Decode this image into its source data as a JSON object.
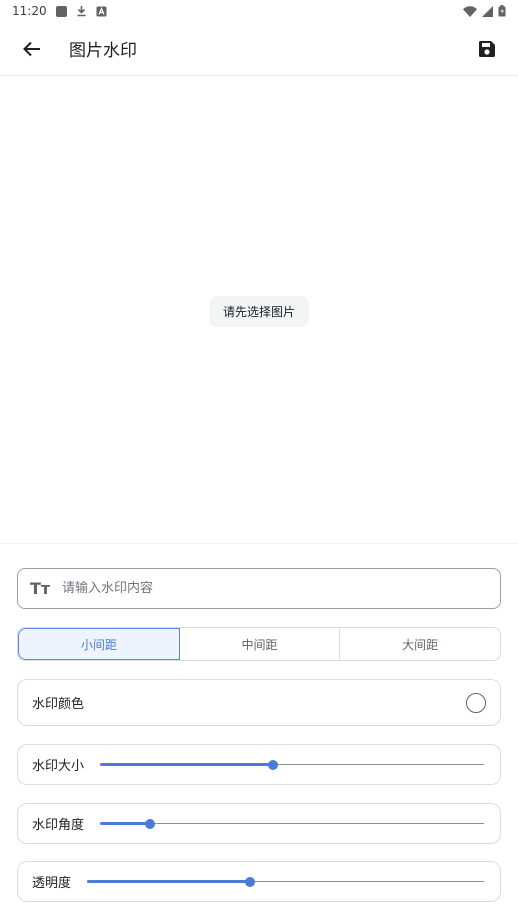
{
  "status_bar": {
    "time": "11:20"
  },
  "app_bar": {
    "title": "图片水印",
    "back_icon": "arrow-back-icon",
    "save_icon": "save-icon"
  },
  "preview": {
    "hint": "请先选择图片"
  },
  "text_input": {
    "placeholder": "请输入水印内容",
    "value": "",
    "icon": "text-fields-icon",
    "icon_glyph": "Tт"
  },
  "spacing": {
    "options": [
      "小间距",
      "中间距",
      "大间距"
    ],
    "selected": "小间距"
  },
  "color": {
    "label": "水印颜色",
    "value": "#ffffff"
  },
  "size": {
    "label": "水印大小",
    "level": 0.45
  },
  "angle": {
    "label": "水印角度",
    "level": 0.13
  },
  "opacity": {
    "label": "透明度",
    "level": 0.41
  },
  "accent_color": "#4a7bd6"
}
